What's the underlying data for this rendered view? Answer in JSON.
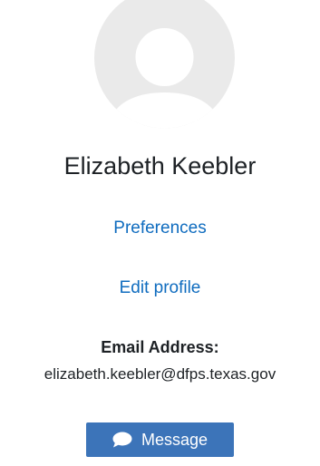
{
  "profile": {
    "avatar_icon": "default-user-avatar-icon",
    "full_name": "Elizabeth Keebler",
    "links": {
      "preferences": "Preferences",
      "edit_profile": "Edit profile"
    },
    "email_label": "Email Address:",
    "email_value": "elizabeth.keebler@dfps.texas.gov",
    "message_button": {
      "label": "Message",
      "icon": "speech-bubble-icon"
    }
  },
  "colors": {
    "link": "#0f6cbf",
    "button_background": "#3c74b9",
    "avatar_background": "#eaeaea",
    "avatar_figure": "#ffffff",
    "text": "#1d2125"
  }
}
